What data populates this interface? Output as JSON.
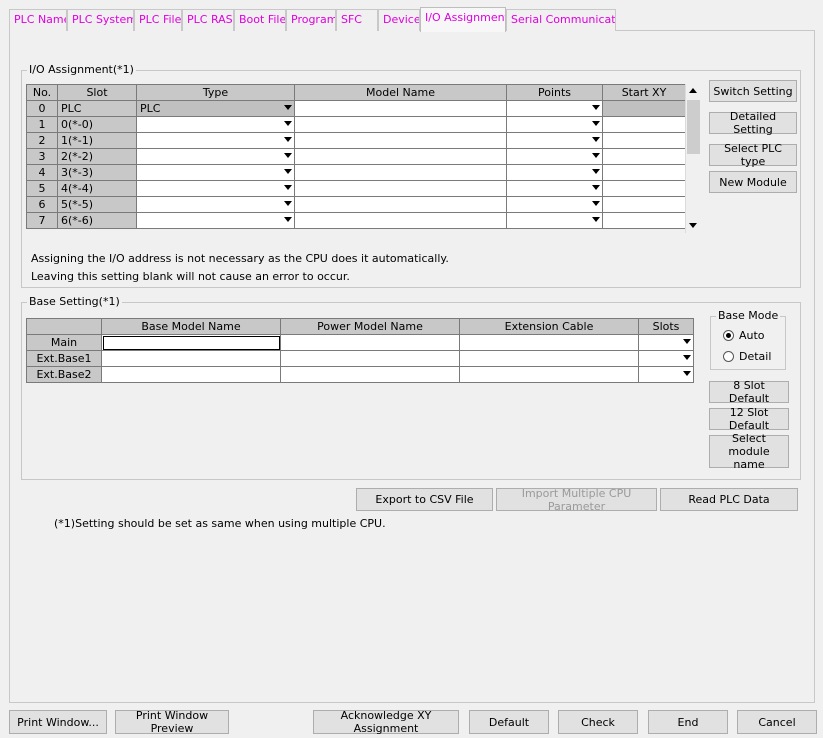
{
  "tabs": [
    {
      "label": "PLC Name"
    },
    {
      "label": "PLC System"
    },
    {
      "label": "PLC File"
    },
    {
      "label": "PLC RAS"
    },
    {
      "label": "Boot File"
    },
    {
      "label": "Program"
    },
    {
      "label": "SFC"
    },
    {
      "label": "Device"
    },
    {
      "label": "I/O Assignment",
      "active": true
    },
    {
      "label": "Serial Communication"
    }
  ],
  "io": {
    "group_title": "I/O Assignment(*1)",
    "headers": [
      "No.",
      "Slot",
      "Type",
      "Model Name",
      "Points",
      "Start XY"
    ],
    "rows": [
      {
        "no": "0",
        "slot": "PLC",
        "type": "PLC",
        "model": "",
        "points": "",
        "start": ""
      },
      {
        "no": "1",
        "slot": "0(*-0)",
        "type": "",
        "model": "",
        "points": "",
        "start": ""
      },
      {
        "no": "2",
        "slot": "1(*-1)",
        "type": "",
        "model": "",
        "points": "",
        "start": ""
      },
      {
        "no": "3",
        "slot": "2(*-2)",
        "type": "",
        "model": "",
        "points": "",
        "start": ""
      },
      {
        "no": "4",
        "slot": "3(*-3)",
        "type": "",
        "model": "",
        "points": "",
        "start": ""
      },
      {
        "no": "5",
        "slot": "4(*-4)",
        "type": "",
        "model": "",
        "points": "",
        "start": ""
      },
      {
        "no": "6",
        "slot": "5(*-5)",
        "type": "",
        "model": "",
        "points": "",
        "start": ""
      },
      {
        "no": "7",
        "slot": "6(*-6)",
        "type": "",
        "model": "",
        "points": "",
        "start": ""
      }
    ],
    "note1": "Assigning the I/O address is not necessary as the CPU does it automatically.",
    "note2": "Leaving this setting blank will not cause an error to occur.",
    "buttons": {
      "switch": "Switch Setting",
      "detailed": "Detailed Setting",
      "select_plc": "Select PLC type",
      "new_module": "New Module"
    }
  },
  "base": {
    "group_title": "Base Setting(*1)",
    "headers": [
      "",
      "Base Model Name",
      "Power Model Name",
      "Extension Cable",
      "Slots"
    ],
    "rows": [
      {
        "name": "Main",
        "model": "",
        "power": "",
        "cable": "",
        "slots": ""
      },
      {
        "name": "Ext.Base1",
        "model": "",
        "power": "",
        "cable": "",
        "slots": ""
      },
      {
        "name": "Ext.Base2",
        "model": "",
        "power": "",
        "cable": "",
        "slots": ""
      }
    ],
    "mode_title": "Base Mode",
    "mode_auto": "Auto",
    "mode_detail": "Detail",
    "mode_selected": "Auto",
    "btn_8slot": "8 Slot Default",
    "btn_12slot": "12 Slot Default",
    "btn_select_module": "Select module name"
  },
  "mid_buttons": {
    "export_csv": "Export to CSV File",
    "import_multi": "Import Multiple CPU Parameter",
    "read_plc": "Read PLC Data"
  },
  "footnote": "(*1)Setting should be set as same when using multiple CPU.",
  "bottom_buttons": {
    "print_window": "Print Window...",
    "print_preview": "Print Window Preview",
    "ack_xy": "Acknowledge XY Assignment",
    "default": "Default",
    "check": "Check",
    "end": "End",
    "cancel": "Cancel"
  },
  "colors": {
    "tab_text": "#e000e0",
    "grid_header": "#c8c8c8",
    "background": "#f0f0f0"
  }
}
